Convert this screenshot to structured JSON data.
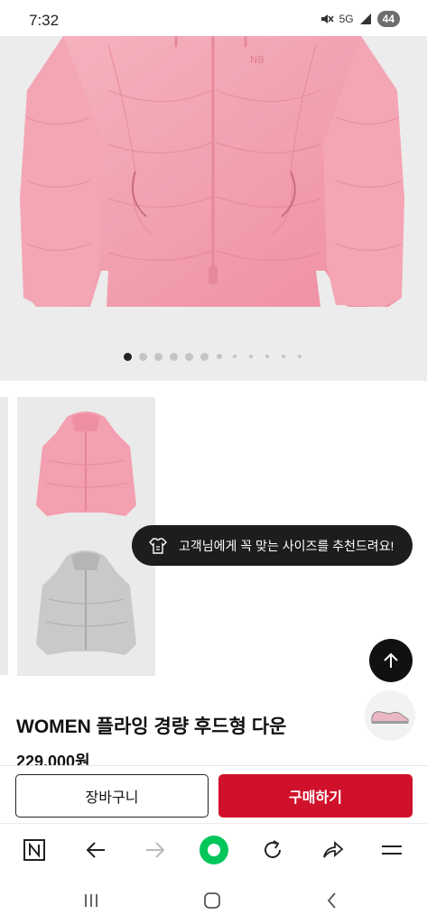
{
  "status_bar": {
    "time": "7:32",
    "mute_icon": "mute-icon",
    "network": "5G",
    "signal_icon": "signal-icon",
    "battery": "44"
  },
  "gallery": {
    "total_dots": 12,
    "active_index": 0,
    "product_color": "#f3a0b0"
  },
  "thumbnails": [
    {
      "name": "pink-jacket-thumbnail",
      "color": "#f3a0b0"
    },
    {
      "name": "gray-jacket-thumbnail",
      "color": "#c8c8c8"
    }
  ],
  "size_tooltip": {
    "icon": "tshirt-ruler-icon",
    "text": "고객님에게 꼭 맞는 사이즈를 추천드려요!"
  },
  "product": {
    "title": "WOMEN 플라잉 경량 후드형 다운",
    "price": "229,000원"
  },
  "actions": {
    "cart_label": "장바구니",
    "buy_label": "구매하기"
  },
  "browser_toolbar": [
    "naver-home-icon",
    "back-arrow-icon",
    "forward-arrow-icon",
    "green-dot-icon",
    "refresh-icon",
    "share-icon",
    "menu-icon"
  ],
  "system_nav": [
    "recents-icon",
    "home-icon",
    "back-icon"
  ],
  "colors": {
    "accent_red": "#d0112b",
    "dark": "#1d1d1d",
    "green": "#03c75a"
  }
}
